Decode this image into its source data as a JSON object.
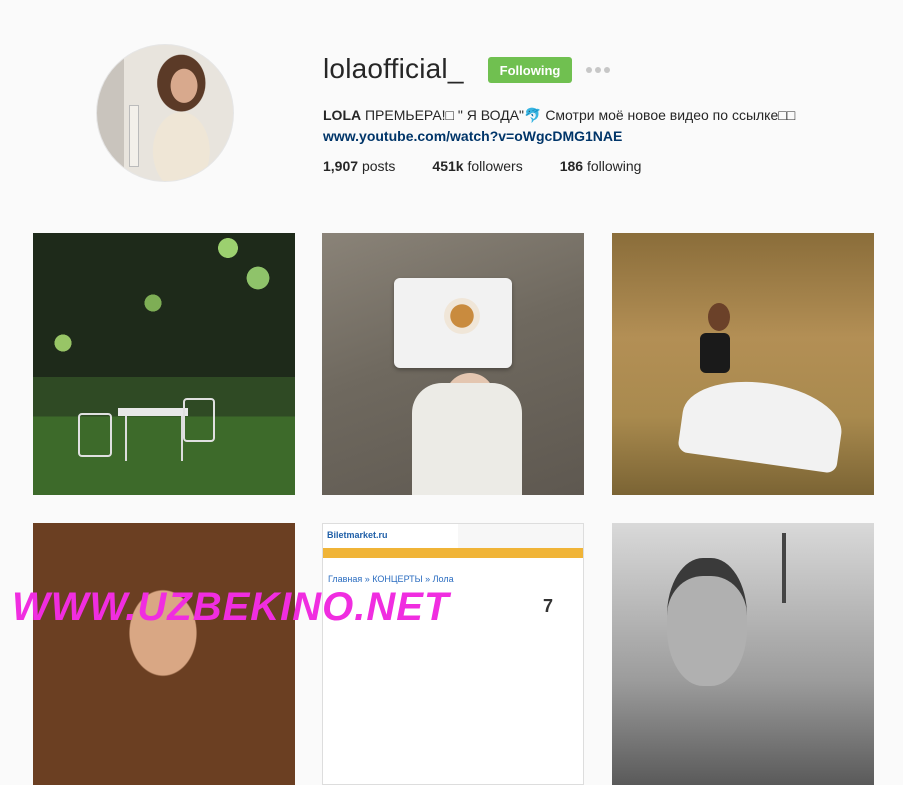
{
  "profile": {
    "username": "lolaofficial_",
    "follow_button_label": "Following",
    "more_icon": "ellipsis-icon",
    "bio_name": "LOLA",
    "bio_text": " ПРЕМЬЕРА!□ \" Я ВОДА\"🐬 Смотри моё новое видео по ссылке□□",
    "bio_link": "www.youtube.com/watch?v=oWgcDMG1NAE"
  },
  "stats": {
    "posts_count": "1,907",
    "posts_label": "posts",
    "followers_count": "451k",
    "followers_label": "followers",
    "following_count": "186",
    "following_label": "following"
  },
  "grid": {
    "posts": [
      "apple-garden-photo",
      "tea-tray-photo",
      "hay-field-photo",
      "portrait-photo",
      "biletmarket-screenshot",
      "bw-selfie-photo"
    ],
    "screenshot_logo": "Biletmarket.ru",
    "screenshot_crumb": "Главная » КОНЦЕРТЫ » Лола",
    "screenshot_date": "7"
  },
  "watermark": "WWW.UZBEKINO.NET",
  "colors": {
    "follow_green": "#70c050",
    "link_blue": "#003569",
    "watermark_pink": "#f02de0"
  }
}
